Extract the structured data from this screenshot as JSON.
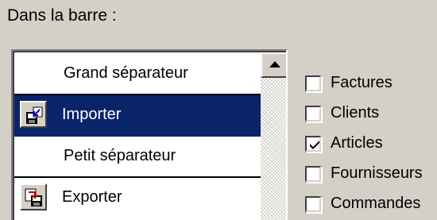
{
  "section_label": "Dans la barre :",
  "list": {
    "items": [
      {
        "label": "Grand séparateur",
        "type": "big-separator",
        "icon": null,
        "selected": false
      },
      {
        "label": "Importer",
        "type": "command",
        "icon": "import-icon",
        "selected": true
      },
      {
        "label": "Petit séparateur",
        "type": "small-separator",
        "icon": null,
        "selected": false
      },
      {
        "label": "Exporter",
        "type": "command",
        "icon": "export-icon",
        "selected": false
      }
    ],
    "scroll_up_icon": "scroll-up-arrow-icon"
  },
  "checkboxes": [
    {
      "label": "Factures",
      "checked": false
    },
    {
      "label": "Clients",
      "checked": false
    },
    {
      "label": "Articles",
      "checked": true
    },
    {
      "label": "Fournisseurs",
      "checked": false
    },
    {
      "label": "Commandes",
      "checked": false
    }
  ],
  "colors": {
    "window_bg": "#d4d0c8",
    "selection_bg": "#0a246a",
    "selection_text": "#ffffff"
  }
}
